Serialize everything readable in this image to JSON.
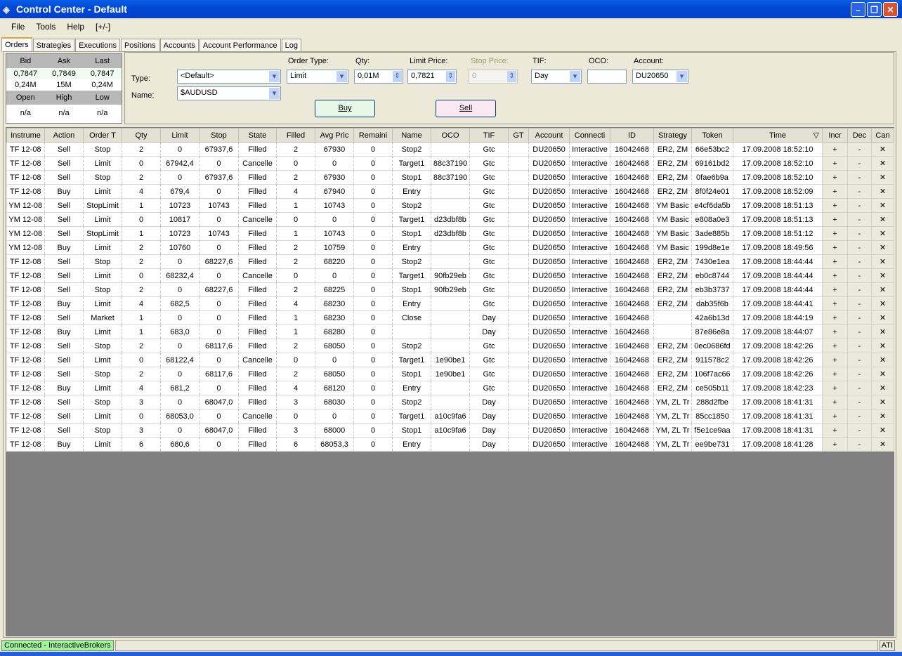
{
  "window": {
    "title": "Control Center - Default",
    "minimize": "–",
    "restore": "❐",
    "close": "✕"
  },
  "menu": [
    "File",
    "Tools",
    "Help",
    "[+/-]"
  ],
  "tabs": [
    "Orders",
    "Strategies",
    "Executions",
    "Positions",
    "Accounts",
    "Account Performance",
    "Log"
  ],
  "quote": {
    "headers1": [
      "Bid",
      "Ask",
      "Last"
    ],
    "prices": [
      "0,7847",
      "0,7849",
      "0,7847"
    ],
    "sizes": [
      "0,24M",
      "15M",
      "0,24M"
    ],
    "headers2": [
      "Open",
      "High",
      "Low"
    ],
    "ohl": [
      "n/a",
      "n/a",
      "n/a"
    ]
  },
  "form": {
    "type_label": "Type:",
    "type_value": "<Default>",
    "name_label": "Name:",
    "name_value": "$AUDUSD",
    "order_type_label": "Order Type:",
    "order_type_value": "Limit",
    "qty_label": "Qty:",
    "qty_value": "0,01M",
    "limit_label": "Limit Price:",
    "limit_value": "0,7821",
    "stop_label": "Stop Price:",
    "stop_value": "0",
    "tif_label": "TIF:",
    "tif_value": "Day",
    "oco_label": "OCO:",
    "oco_value": "",
    "account_label": "Account:",
    "account_value": "DU20650",
    "buy": "Buy",
    "sell": "Sell"
  },
  "colors": {
    "buy_bg": "#e8f8e8",
    "sell_bg": "#fbe8f0",
    "connected": "#9ef59e"
  },
  "table": {
    "columns": [
      "Instrume",
      "Action",
      "Order T",
      "Qty",
      "Limit",
      "Stop",
      "State",
      "Filled",
      "Avg Pric",
      "Remaini",
      "Name",
      "OCO",
      "TIF",
      "GT",
      "Account",
      "Connecti",
      "ID",
      "Strategy",
      "Token",
      "Time",
      "Incr",
      "Dec",
      "Can"
    ],
    "sort_column": "Time",
    "sort_icon": "▽",
    "action_labels": {
      "incr": "+",
      "dec": "-",
      "cancel": "✕"
    },
    "rows": [
      [
        "TF 12-08",
        "Sell",
        "Stop",
        "2",
        "0",
        "67937,6",
        "Filled",
        "2",
        "67930",
        "0",
        "Stop2",
        "",
        "Gtc",
        "",
        "DU20650",
        "Interactive",
        "16042468",
        "ER2, ZM",
        "66e53bc2",
        "17.09.2008 18:52:10"
      ],
      [
        "TF 12-08",
        "Sell",
        "Limit",
        "0",
        "67942,4",
        "0",
        "Cancelle",
        "0",
        "0",
        "0",
        "Target1",
        "88c37190",
        "Gtc",
        "",
        "DU20650",
        "Interactive",
        "16042468",
        "ER2, ZM",
        "69161bd2",
        "17.09.2008 18:52:10"
      ],
      [
        "TF 12-08",
        "Sell",
        "Stop",
        "2",
        "0",
        "67937,6",
        "Filled",
        "2",
        "67930",
        "0",
        "Stop1",
        "88c37190",
        "Gtc",
        "",
        "DU20650",
        "Interactive",
        "16042468",
        "ER2, ZM",
        "0fae6b9a",
        "17.09.2008 18:52:10"
      ],
      [
        "TF 12-08",
        "Buy",
        "Limit",
        "4",
        "679,4",
        "0",
        "Filled",
        "4",
        "67940",
        "0",
        "Entry",
        "",
        "Gtc",
        "",
        "DU20650",
        "Interactive",
        "16042468",
        "ER2, ZM",
        "8f0f24e01",
        "17.09.2008 18:52:09"
      ],
      [
        "YM 12-08",
        "Sell",
        "StopLimit",
        "1",
        "10723",
        "10743",
        "Filled",
        "1",
        "10743",
        "0",
        "Stop2",
        "",
        "Gtc",
        "",
        "DU20650",
        "Interactive",
        "16042468",
        "YM Basic",
        "e4cf6da5b",
        "17.09.2008 18:51:13"
      ],
      [
        "YM 12-08",
        "Sell",
        "Limit",
        "0",
        "10817",
        "0",
        "Cancelle",
        "0",
        "0",
        "0",
        "Target1",
        "d23dbf8b",
        "Gtc",
        "",
        "DU20650",
        "Interactive",
        "16042468",
        "YM Basic",
        "e808a0e3",
        "17.09.2008 18:51:13"
      ],
      [
        "YM 12-08",
        "Sell",
        "StopLimit",
        "1",
        "10723",
        "10743",
        "Filled",
        "1",
        "10743",
        "0",
        "Stop1",
        "d23dbf8b",
        "Gtc",
        "",
        "DU20650",
        "Interactive",
        "16042468",
        "YM Basic",
        "3ade885b",
        "17.09.2008 18:51:12"
      ],
      [
        "YM 12-08",
        "Buy",
        "Limit",
        "2",
        "10760",
        "0",
        "Filled",
        "2",
        "10759",
        "0",
        "Entry",
        "",
        "Gtc",
        "",
        "DU20650",
        "Interactive",
        "16042468",
        "YM Basic",
        "199d8e1e",
        "17.09.2008 18:49:56"
      ],
      [
        "TF 12-08",
        "Sell",
        "Stop",
        "2",
        "0",
        "68227,6",
        "Filled",
        "2",
        "68220",
        "0",
        "Stop2",
        "",
        "Gtc",
        "",
        "DU20650",
        "Interactive",
        "16042468",
        "ER2, ZM",
        "7430e1ea",
        "17.09.2008 18:44:44"
      ],
      [
        "TF 12-08",
        "Sell",
        "Limit",
        "0",
        "68232,4",
        "0",
        "Cancelle",
        "0",
        "0",
        "0",
        "Target1",
        "90fb29eb",
        "Gtc",
        "",
        "DU20650",
        "Interactive",
        "16042468",
        "ER2, ZM",
        "eb0c8744",
        "17.09.2008 18:44:44"
      ],
      [
        "TF 12-08",
        "Sell",
        "Stop",
        "2",
        "0",
        "68227,6",
        "Filled",
        "2",
        "68225",
        "0",
        "Stop1",
        "90fb29eb",
        "Gtc",
        "",
        "DU20650",
        "Interactive",
        "16042468",
        "ER2, ZM",
        "eb3b3737",
        "17.09.2008 18:44:44"
      ],
      [
        "TF 12-08",
        "Buy",
        "Limit",
        "4",
        "682,5",
        "0",
        "Filled",
        "4",
        "68230",
        "0",
        "Entry",
        "",
        "Gtc",
        "",
        "DU20650",
        "Interactive",
        "16042468",
        "ER2, ZM",
        "dab35f6b",
        "17.09.2008 18:44:41"
      ],
      [
        "TF 12-08",
        "Sell",
        "Market",
        "1",
        "0",
        "0",
        "Filled",
        "1",
        "68230",
        "0",
        "Close",
        "",
        "Day",
        "",
        "DU20650",
        "Interactive",
        "16042468",
        "",
        "42a6b13d",
        "17.09.2008 18:44:19"
      ],
      [
        "TF 12-08",
        "Buy",
        "Limit",
        "1",
        "683,0",
        "0",
        "Filled",
        "1",
        "68280",
        "0",
        "",
        "",
        "Day",
        "",
        "DU20650",
        "Interactive",
        "16042468",
        "",
        "87e86e8a",
        "17.09.2008 18:44:07"
      ],
      [
        "TF 12-08",
        "Sell",
        "Stop",
        "2",
        "0",
        "68117,6",
        "Filled",
        "2",
        "68050",
        "0",
        "Stop2",
        "",
        "Gtc",
        "",
        "DU20650",
        "Interactive",
        "16042468",
        "ER2, ZM",
        "0ec0686fd",
        "17.09.2008 18:42:26"
      ],
      [
        "TF 12-08",
        "Sell",
        "Limit",
        "0",
        "68122,4",
        "0",
        "Cancelle",
        "0",
        "0",
        "0",
        "Target1",
        "1e90be1",
        "Gtc",
        "",
        "DU20650",
        "Interactive",
        "16042468",
        "ER2, ZM",
        "911578c2",
        "17.09.2008 18:42:26"
      ],
      [
        "TF 12-08",
        "Sell",
        "Stop",
        "2",
        "0",
        "68117,6",
        "Filled",
        "2",
        "68050",
        "0",
        "Stop1",
        "1e90be1",
        "Gtc",
        "",
        "DU20650",
        "Interactive",
        "16042468",
        "ER2, ZM",
        "106f7ac66",
        "17.09.2008 18:42:26"
      ],
      [
        "TF 12-08",
        "Buy",
        "Limit",
        "4",
        "681,2",
        "0",
        "Filled",
        "4",
        "68120",
        "0",
        "Entry",
        "",
        "Gtc",
        "",
        "DU20650",
        "Interactive",
        "16042468",
        "ER2, ZM",
        "ce505b11",
        "17.09.2008 18:42:23"
      ],
      [
        "TF 12-08",
        "Sell",
        "Stop",
        "3",
        "0",
        "68047,0",
        "Filled",
        "3",
        "68030",
        "0",
        "Stop2",
        "",
        "Day",
        "",
        "DU20650",
        "Interactive",
        "16042468",
        "YM, ZL Tr",
        "288d2fbe",
        "17.09.2008 18:41:31"
      ],
      [
        "TF 12-08",
        "Sell",
        "Limit",
        "0",
        "68053,0",
        "0",
        "Cancelle",
        "0",
        "0",
        "0",
        "Target1",
        "a10c9fa6",
        "Day",
        "",
        "DU20650",
        "Interactive",
        "16042468",
        "YM, ZL Tr",
        "85cc1850",
        "17.09.2008 18:41:31"
      ],
      [
        "TF 12-08",
        "Sell",
        "Stop",
        "3",
        "0",
        "68047,0",
        "Filled",
        "3",
        "68000",
        "0",
        "Stop1",
        "a10c9fa6",
        "Day",
        "",
        "DU20650",
        "Interactive",
        "16042468",
        "YM, ZL Tr",
        "f5e1ce9aa",
        "17.09.2008 18:41:31"
      ],
      [
        "TF 12-08",
        "Buy",
        "Limit",
        "6",
        "680,6",
        "0",
        "Filled",
        "6",
        "68053,3",
        "0",
        "Entry",
        "",
        "Day",
        "",
        "DU20650",
        "Interactive",
        "16042468",
        "YM, ZL Tr",
        "ee9be731",
        "17.09.2008 18:41:28"
      ]
    ]
  },
  "status": {
    "connection": "Connected - InteractiveBrokers",
    "right": "ATI"
  }
}
